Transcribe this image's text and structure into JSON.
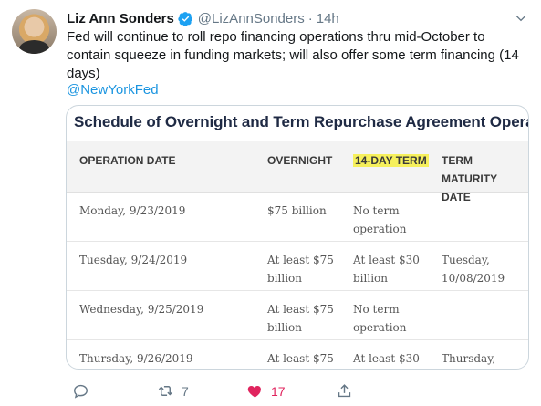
{
  "tweet": {
    "author_name": "Liz Ann Sonders",
    "handle": "@LizAnnSonders",
    "separator": "·",
    "time": "14h",
    "text": "Fed will continue to roll repo financing operations thru mid-October to\ncontain squeeze in funding markets; will also offer some term financing (14\ndays)",
    "mention": "@NewYorkFed"
  },
  "card": {
    "title": "Schedule of Overnight and Term Repurchase Agreement Operations",
    "headers": [
      "OPERATION DATE",
      "OVERNIGHT",
      "14-DAY TERM",
      "TERM MATURITY\nDATE"
    ],
    "rows": [
      [
        "Monday, 9/23/2019",
        "$75 billion",
        "No term\noperation",
        ""
      ],
      [
        "Tuesday, 9/24/2019",
        "At least $75\nbillion",
        "At least $30\nbillion",
        "Tuesday,\n10/08/2019"
      ],
      [
        "Wednesday, 9/25/2019",
        "At least $75\nbillion",
        "No term\noperation",
        ""
      ],
      [
        "Thursday, 9/26/2019",
        "At least $75",
        "At least $30",
        "Thursday,"
      ]
    ]
  },
  "actions": {
    "reply_count": "",
    "retweet_count": "7",
    "like_count": "17",
    "share_count": ""
  },
  "colors": {
    "link": "#1b95e0",
    "secondary": "#657786",
    "like": "#e0245e",
    "highlight": "#f6f05c"
  },
  "icons": [
    "verified-badge-icon",
    "caret-down-icon",
    "reply-icon",
    "retweet-icon",
    "heart-icon",
    "share-icon"
  ]
}
